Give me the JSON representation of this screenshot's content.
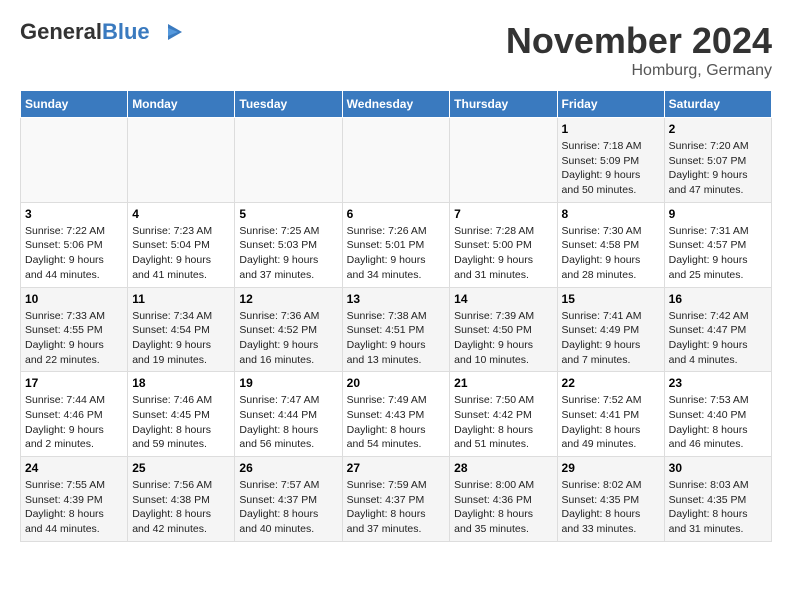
{
  "header": {
    "logo_general": "General",
    "logo_blue": "Blue",
    "month_title": "November 2024",
    "location": "Homburg, Germany"
  },
  "weekdays": [
    "Sunday",
    "Monday",
    "Tuesday",
    "Wednesday",
    "Thursday",
    "Friday",
    "Saturday"
  ],
  "weeks": [
    [
      {
        "day": "",
        "info": ""
      },
      {
        "day": "",
        "info": ""
      },
      {
        "day": "",
        "info": ""
      },
      {
        "day": "",
        "info": ""
      },
      {
        "day": "",
        "info": ""
      },
      {
        "day": "1",
        "info": "Sunrise: 7:18 AM\nSunset: 5:09 PM\nDaylight: 9 hours\nand 50 minutes."
      },
      {
        "day": "2",
        "info": "Sunrise: 7:20 AM\nSunset: 5:07 PM\nDaylight: 9 hours\nand 47 minutes."
      }
    ],
    [
      {
        "day": "3",
        "info": "Sunrise: 7:22 AM\nSunset: 5:06 PM\nDaylight: 9 hours\nand 44 minutes."
      },
      {
        "day": "4",
        "info": "Sunrise: 7:23 AM\nSunset: 5:04 PM\nDaylight: 9 hours\nand 41 minutes."
      },
      {
        "day": "5",
        "info": "Sunrise: 7:25 AM\nSunset: 5:03 PM\nDaylight: 9 hours\nand 37 minutes."
      },
      {
        "day": "6",
        "info": "Sunrise: 7:26 AM\nSunset: 5:01 PM\nDaylight: 9 hours\nand 34 minutes."
      },
      {
        "day": "7",
        "info": "Sunrise: 7:28 AM\nSunset: 5:00 PM\nDaylight: 9 hours\nand 31 minutes."
      },
      {
        "day": "8",
        "info": "Sunrise: 7:30 AM\nSunset: 4:58 PM\nDaylight: 9 hours\nand 28 minutes."
      },
      {
        "day": "9",
        "info": "Sunrise: 7:31 AM\nSunset: 4:57 PM\nDaylight: 9 hours\nand 25 minutes."
      }
    ],
    [
      {
        "day": "10",
        "info": "Sunrise: 7:33 AM\nSunset: 4:55 PM\nDaylight: 9 hours\nand 22 minutes."
      },
      {
        "day": "11",
        "info": "Sunrise: 7:34 AM\nSunset: 4:54 PM\nDaylight: 9 hours\nand 19 minutes."
      },
      {
        "day": "12",
        "info": "Sunrise: 7:36 AM\nSunset: 4:52 PM\nDaylight: 9 hours\nand 16 minutes."
      },
      {
        "day": "13",
        "info": "Sunrise: 7:38 AM\nSunset: 4:51 PM\nDaylight: 9 hours\nand 13 minutes."
      },
      {
        "day": "14",
        "info": "Sunrise: 7:39 AM\nSunset: 4:50 PM\nDaylight: 9 hours\nand 10 minutes."
      },
      {
        "day": "15",
        "info": "Sunrise: 7:41 AM\nSunset: 4:49 PM\nDaylight: 9 hours\nand 7 minutes."
      },
      {
        "day": "16",
        "info": "Sunrise: 7:42 AM\nSunset: 4:47 PM\nDaylight: 9 hours\nand 4 minutes."
      }
    ],
    [
      {
        "day": "17",
        "info": "Sunrise: 7:44 AM\nSunset: 4:46 PM\nDaylight: 9 hours\nand 2 minutes."
      },
      {
        "day": "18",
        "info": "Sunrise: 7:46 AM\nSunset: 4:45 PM\nDaylight: 8 hours\nand 59 minutes."
      },
      {
        "day": "19",
        "info": "Sunrise: 7:47 AM\nSunset: 4:44 PM\nDaylight: 8 hours\nand 56 minutes."
      },
      {
        "day": "20",
        "info": "Sunrise: 7:49 AM\nSunset: 4:43 PM\nDaylight: 8 hours\nand 54 minutes."
      },
      {
        "day": "21",
        "info": "Sunrise: 7:50 AM\nSunset: 4:42 PM\nDaylight: 8 hours\nand 51 minutes."
      },
      {
        "day": "22",
        "info": "Sunrise: 7:52 AM\nSunset: 4:41 PM\nDaylight: 8 hours\nand 49 minutes."
      },
      {
        "day": "23",
        "info": "Sunrise: 7:53 AM\nSunset: 4:40 PM\nDaylight: 8 hours\nand 46 minutes."
      }
    ],
    [
      {
        "day": "24",
        "info": "Sunrise: 7:55 AM\nSunset: 4:39 PM\nDaylight: 8 hours\nand 44 minutes."
      },
      {
        "day": "25",
        "info": "Sunrise: 7:56 AM\nSunset: 4:38 PM\nDaylight: 8 hours\nand 42 minutes."
      },
      {
        "day": "26",
        "info": "Sunrise: 7:57 AM\nSunset: 4:37 PM\nDaylight: 8 hours\nand 40 minutes."
      },
      {
        "day": "27",
        "info": "Sunrise: 7:59 AM\nSunset: 4:37 PM\nDaylight: 8 hours\nand 37 minutes."
      },
      {
        "day": "28",
        "info": "Sunrise: 8:00 AM\nSunset: 4:36 PM\nDaylight: 8 hours\nand 35 minutes."
      },
      {
        "day": "29",
        "info": "Sunrise: 8:02 AM\nSunset: 4:35 PM\nDaylight: 8 hours\nand 33 minutes."
      },
      {
        "day": "30",
        "info": "Sunrise: 8:03 AM\nSunset: 4:35 PM\nDaylight: 8 hours\nand 31 minutes."
      }
    ]
  ]
}
